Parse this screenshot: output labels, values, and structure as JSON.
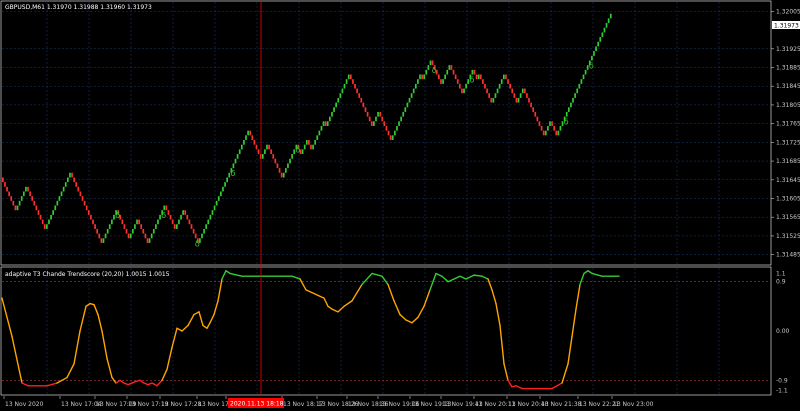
{
  "main_header": "GBPUSD,M61  1.31970 1.31988 1.31960 1.31973",
  "indicator_header": "adaptive T3 Chande Trendscore (20,20) 1.0015 1.0015",
  "current_price_label": "1.31973",
  "crosshair_time_label": "2020.11.13 18:18",
  "colors": {
    "background": "#000000",
    "up_brick": "#32cd32",
    "down_brick": "#ff3030",
    "indicator_up": "#32cd32",
    "indicator_mid": "#ffa500",
    "indicator_down": "#ff2020",
    "level_line": "#b04040",
    "crosshair": "#ff0000",
    "grid": "#1e3a6e",
    "axis_text": "#c8c8c8"
  },
  "chart_data": [
    {
      "type": "line",
      "title": "GBPUSD,M61",
      "style": "renko-bricks",
      "ylim": [
        1.31465,
        1.32025
      ],
      "y_ticks": [
        "1.32005",
        "1.31925",
        "1.31885",
        "1.31845",
        "1.31805",
        "1.31765",
        "1.31725",
        "1.31685",
        "1.31645",
        "1.31605",
        "1.31565",
        "1.31525",
        "1.31485"
      ],
      "x_ticks": [
        "13 Nov 2020",
        "13 Nov 17:04",
        "13 Nov 17:09",
        "13 Nov 17:19",
        "13 Nov 17:28",
        "13 Nov 17:38",
        "13 Nov 17:51",
        "13 Nov 18:17",
        "13 Nov 18:26",
        "13 Nov 18:36",
        "13 Nov 19:06",
        "13 Nov 19:13",
        "13 Nov 19:41",
        "13 Nov 20:11",
        "13 Nov 20:40",
        "13 Nov 21:38",
        "13 Nov 22:21",
        "13 Nov 23:00"
      ],
      "grid": true,
      "series": [
        {
          "brick_size": 0.0001,
          "close_values": [
            1.3164,
            1.3163,
            1.3162,
            1.3161,
            1.316,
            1.3159,
            1.3158,
            1.3159,
            1.316,
            1.3161,
            1.3162,
            1.3163,
            1.3162,
            1.3161,
            1.316,
            1.3159,
            1.3158,
            1.3157,
            1.3156,
            1.3155,
            1.3154,
            1.3155,
            1.3156,
            1.3157,
            1.3158,
            1.3159,
            1.316,
            1.3161,
            1.3162,
            1.3163,
            1.3164,
            1.3165,
            1.3166,
            1.3165,
            1.3164,
            1.3163,
            1.3162,
            1.3161,
            1.316,
            1.3159,
            1.3158,
            1.3157,
            1.3156,
            1.3155,
            1.3154,
            1.3153,
            1.3152,
            1.3151,
            1.3152,
            1.3153,
            1.3154,
            1.3155,
            1.3156,
            1.3157,
            1.3158,
            1.3157,
            1.3156,
            1.3155,
            1.3154,
            1.3153,
            1.3152,
            1.3153,
            1.3154,
            1.3155,
            1.3156,
            1.3155,
            1.3154,
            1.3153,
            1.3152,
            1.3151,
            1.3152,
            1.3153,
            1.3154,
            1.3155,
            1.3156,
            1.3157,
            1.3158,
            1.3159,
            1.3158,
            1.3157,
            1.3156,
            1.3155,
            1.3154,
            1.3155,
            1.3156,
            1.3157,
            1.3158,
            1.3157,
            1.3156,
            1.3155,
            1.3154,
            1.3153,
            1.3152,
            1.3151,
            1.3152,
            1.3153,
            1.3154,
            1.3155,
            1.3156,
            1.3157,
            1.3158,
            1.3159,
            1.316,
            1.3161,
            1.3162,
            1.3163,
            1.3164,
            1.3165,
            1.3166,
            1.3167,
            1.3168,
            1.3169,
            1.317,
            1.3171,
            1.3172,
            1.3173,
            1.3174,
            1.3175,
            1.3174,
            1.3173,
            1.3172,
            1.3171,
            1.317,
            1.3169,
            1.317,
            1.3171,
            1.3172,
            1.3171,
            1.317,
            1.3169,
            1.3168,
            1.3167,
            1.3166,
            1.3165,
            1.3166,
            1.3167,
            1.3168,
            1.3169,
            1.317,
            1.3171,
            1.3172,
            1.3171,
            1.317,
            1.3171,
            1.3172,
            1.3173,
            1.3172,
            1.3171,
            1.3172,
            1.3173,
            1.3174,
            1.3175,
            1.3176,
            1.3177,
            1.3176,
            1.3177,
            1.3178,
            1.3179,
            1.318,
            1.3181,
            1.3182,
            1.3183,
            1.3184,
            1.3185,
            1.3186,
            1.3187,
            1.3186,
            1.3185,
            1.3184,
            1.3183,
            1.3182,
            1.3181,
            1.318,
            1.3179,
            1.3178,
            1.3177,
            1.3176,
            1.3177,
            1.3178,
            1.3179,
            1.3178,
            1.3177,
            1.3176,
            1.3175,
            1.3174,
            1.3173,
            1.3174,
            1.3175,
            1.3176,
            1.3177,
            1.3178,
            1.3179,
            1.318,
            1.3181,
            1.3182,
            1.3183,
            1.3184,
            1.3185,
            1.3186,
            1.3187,
            1.3186,
            1.3187,
            1.3188,
            1.3189,
            1.319,
            1.3189,
            1.3188,
            1.3187,
            1.3186,
            1.3185,
            1.3186,
            1.3187,
            1.3188,
            1.3189,
            1.3188,
            1.3187,
            1.3186,
            1.3185,
            1.3184,
            1.3183,
            1.3184,
            1.3185,
            1.3186,
            1.3187,
            1.3188,
            1.3187,
            1.3186,
            1.3187,
            1.3186,
            1.3185,
            1.3184,
            1.3183,
            1.3182,
            1.3181,
            1.3182,
            1.3183,
            1.3184,
            1.3185,
            1.3186,
            1.3187,
            1.3186,
            1.3185,
            1.3184,
            1.3183,
            1.3182,
            1.3181,
            1.3182,
            1.3183,
            1.3184,
            1.3183,
            1.3182,
            1.3181,
            1.318,
            1.3179,
            1.3178,
            1.3177,
            1.3176,
            1.3175,
            1.3174,
            1.3175,
            1.3176,
            1.3177,
            1.3176,
            1.3175,
            1.3174,
            1.3175,
            1.3176,
            1.3177,
            1.3178,
            1.3179,
            1.318,
            1.3181,
            1.3182,
            1.3183,
            1.3184,
            1.3185,
            1.3186,
            1.3187,
            1.3188,
            1.3189,
            1.319,
            1.3191,
            1.3192,
            1.3193,
            1.3194,
            1.3195,
            1.3196,
            1.3197,
            1.3198,
            1.3199,
            1.32
          ]
        }
      ],
      "markers": [
        {
          "label": "δ",
          "after_brick": 54
        },
        {
          "label": "δ",
          "after_brick": 76
        },
        {
          "label": "δ",
          "after_brick": 92
        },
        {
          "label": "δ",
          "after_brick": 109
        },
        {
          "label": "δ",
          "after_brick": 140
        },
        {
          "label": "δ",
          "after_brick": 205
        },
        {
          "label": "δ",
          "after_brick": 223
        },
        {
          "label": "δ",
          "after_brick": 268
        },
        {
          "label": "δ",
          "after_brick": 280
        }
      ]
    },
    {
      "type": "line",
      "title": "adaptive T3 Chande Trendscore (20,20)",
      "ylim": [
        -1.15,
        1.15
      ],
      "y_ticks": [
        "1.1",
        "0.9",
        "0.00",
        "-0.9",
        "-1.1"
      ],
      "levels": [
        0.9,
        -0.9
      ],
      "series": [
        {
          "x": [
            0,
            10,
            20,
            26,
            34,
            45,
            55,
            65,
            72,
            78,
            84,
            88,
            92,
            96,
            100,
            105,
            110,
            114,
            118,
            122,
            126,
            130,
            134,
            138,
            142,
            146,
            150,
            155,
            160,
            165,
            170,
            175,
            180,
            186,
            192,
            197,
            201,
            205,
            208,
            212,
            216,
            220,
            224,
            228,
            240,
            250,
            260,
            270,
            280,
            290,
            298,
            304,
            310,
            316,
            322,
            326,
            330,
            336,
            342,
            350,
            360,
            370,
            380,
            386,
            392,
            398,
            404,
            410,
            416,
            422,
            428,
            434,
            440,
            446,
            452,
            458,
            464,
            472,
            480,
            486,
            490,
            494,
            498,
            502,
            506,
            510,
            514,
            520,
            530,
            540,
            550,
            560,
            566,
            570,
            574,
            578,
            582,
            586,
            590,
            600,
            610,
            617
          ],
          "y": [
            0.6,
            -0.1,
            -0.95,
            -1.0,
            -1.0,
            -1.0,
            -0.95,
            -0.85,
            -0.6,
            0.0,
            0.45,
            0.5,
            0.48,
            0.3,
            0.0,
            -0.5,
            -0.85,
            -0.95,
            -0.9,
            -0.95,
            -0.98,
            -0.95,
            -0.92,
            -0.9,
            -0.95,
            -0.98,
            -0.95,
            -1.0,
            -0.9,
            -0.7,
            -0.3,
            0.05,
            0.0,
            0.1,
            0.3,
            0.35,
            0.1,
            0.05,
            0.15,
            0.3,
            0.55,
            0.95,
            1.1,
            1.05,
            1.0,
            1.0,
            1.0,
            1.0,
            1.0,
            1.0,
            0.95,
            0.75,
            0.7,
            0.65,
            0.6,
            0.45,
            0.4,
            0.35,
            0.45,
            0.55,
            0.85,
            1.05,
            1.0,
            0.85,
            0.55,
            0.3,
            0.2,
            0.15,
            0.25,
            0.45,
            0.75,
            1.05,
            1.0,
            0.9,
            0.95,
            1.0,
            0.95,
            1.02,
            1.0,
            0.95,
            0.75,
            0.5,
            0.1,
            -0.6,
            -0.9,
            -1.02,
            -1.0,
            -1.05,
            -1.05,
            -1.05,
            -1.05,
            -0.95,
            -0.6,
            -0.1,
            0.4,
            0.85,
            1.05,
            1.1,
            1.05,
            1.0,
            1.0,
            1.0
          ]
        }
      ]
    }
  ]
}
